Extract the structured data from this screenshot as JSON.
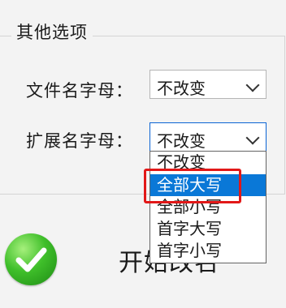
{
  "group": {
    "title": "其他选项"
  },
  "file_letter": {
    "label": "文件名字母：",
    "value": "不改变"
  },
  "ext_letter": {
    "label": "扩展名字母：",
    "value": "不改变",
    "options": [
      "不改变",
      "全部大写",
      "全部小写",
      "首字大写",
      "首字小写"
    ],
    "highlighted_index": 1
  },
  "start": {
    "label": "开始改名"
  },
  "colors": {
    "selection": "#0a78d7",
    "annotation": "#e21818",
    "icon": "#3fbf2a"
  }
}
